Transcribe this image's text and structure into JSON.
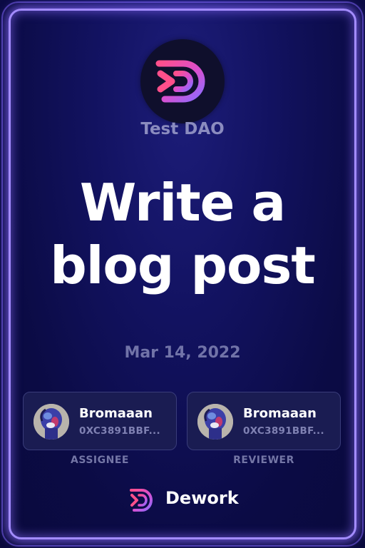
{
  "dao": {
    "name": "Test DAO",
    "logo_icon": "dework-logo-icon"
  },
  "task": {
    "title": "Write a blog post",
    "date": "Mar 14, 2022"
  },
  "assignee": {
    "name": "Bromaaan",
    "address": "0XC3891BBF...",
    "role_label": "ASSIGNEE"
  },
  "reviewer": {
    "name": "Bromaaan",
    "address": "0XC3891BBF...",
    "role_label": "REVIEWER"
  },
  "footer": {
    "brand": "Dework"
  },
  "colors": {
    "background": "#0b0b45",
    "frame_glow": "#a38cff",
    "logo_pink": "#ff3d8b",
    "logo_purple": "#8b5cf6",
    "muted_text": "#8b8cbf"
  }
}
